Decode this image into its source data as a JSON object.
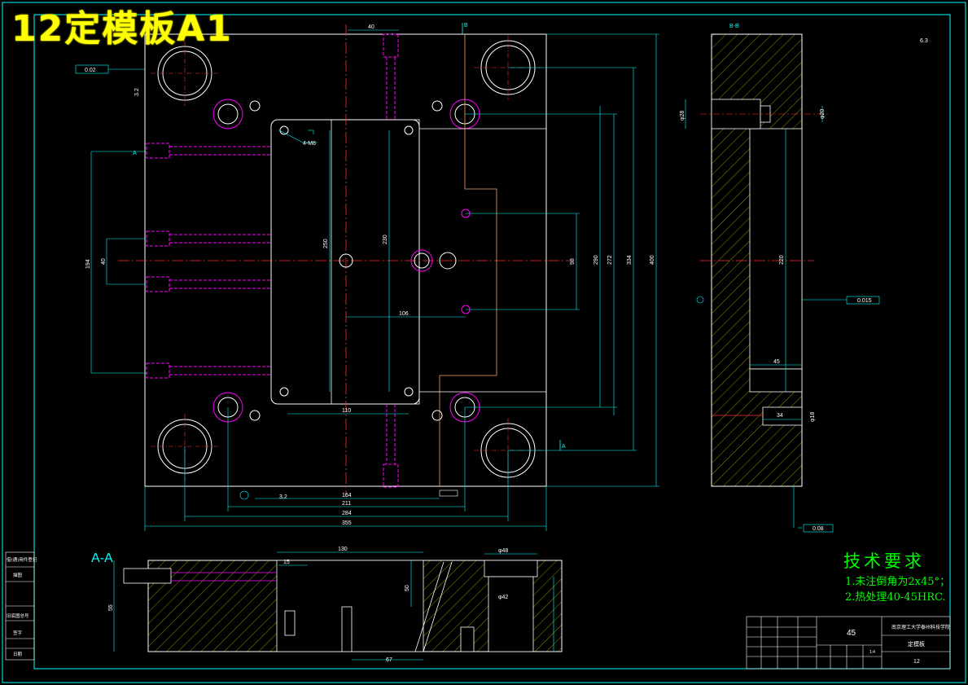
{
  "drawing": {
    "title": "12定模板A1"
  },
  "view_labels": {
    "section_aa": "A-A",
    "section_bb": "B-B",
    "marker_a": "A",
    "marker_b": "B"
  },
  "front_view_dims": {
    "d40_top": "40",
    "d164": "164",
    "d211": "211",
    "d284": "284",
    "d355": "355",
    "d110": "110",
    "d106": "106",
    "d250": "250",
    "d230": "230",
    "d98": "98",
    "d290": "290",
    "d272": "272",
    "d334": "334",
    "d400": "400",
    "d194": "194",
    "d40_left": "40",
    "thread_callout": "4-M8",
    "flatness": "0.02",
    "ra_left": "3.2",
    "ra_bottom": "3.2"
  },
  "section_bb_dims": {
    "d220": "220",
    "d45": "45",
    "d34": "34",
    "phi18": "φ18",
    "phi28": "φ28",
    "phi20": "φ20",
    "ra": "6.3",
    "perp": "0.015",
    "parallel": "0.08"
  },
  "section_aa_dims": {
    "d15": "15",
    "d130": "130",
    "d50": "50",
    "d67": "67",
    "d55": "55",
    "phi42": "φ42",
    "phi48": "φ48"
  },
  "tech_requirements": {
    "heading": "技术要求",
    "item1": "1.未注倒角为2x45°；",
    "item2": "2.热处理40-45HRC."
  },
  "title_block": {
    "material": "45",
    "company": "南京理工大学泰州科技学院",
    "part_name": "定模板",
    "drawing_no": "12",
    "scale": "1:4"
  },
  "side_table": [
    "借(通)用件登记",
    "旧底图总号",
    "签字",
    "日期",
    "描图"
  ]
}
